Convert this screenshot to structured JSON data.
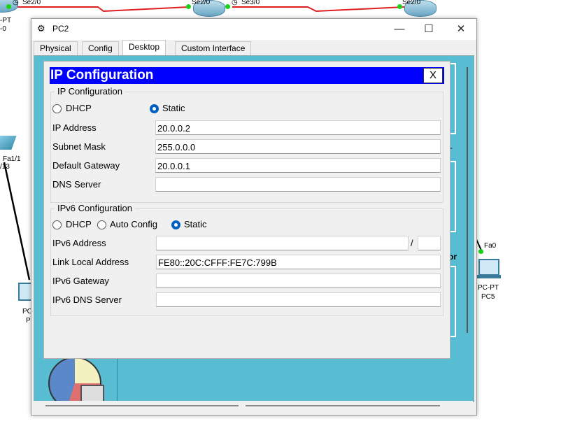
{
  "topology": {
    "top_labels": [
      "Se2/0",
      "Se2/0",
      "Se3/0",
      "Se2/0"
    ],
    "left_labels": [
      "-PT",
      "-0",
      "Fa1/1",
      "/13",
      "PC",
      "P"
    ],
    "right_pc": {
      "port": "Fa0",
      "type": "PC-PT",
      "name": "PC5"
    },
    "link_color": "#e02020"
  },
  "window": {
    "title": "PC2",
    "controls": {
      "minimize": "—",
      "maximize": "☐",
      "close": "✕"
    },
    "tabs": [
      {
        "label": "Physical",
        "active": false
      },
      {
        "label": "Config",
        "active": false
      },
      {
        "label": "Desktop",
        "active": true
      },
      {
        "label": "Custom Interface",
        "active": false
      }
    ],
    "desktop_side_text": {
      "or": "or",
      "bar": "l",
      "dash": "-"
    }
  },
  "ip_config": {
    "title": "IP Configuration",
    "close_label": "X",
    "ipv4": {
      "legend": "IP Configuration",
      "mode_options": [
        "DHCP",
        "Static"
      ],
      "selected_mode": "Static",
      "fields": {
        "ip_address": {
          "label": "IP Address",
          "value": "20.0.0.2"
        },
        "subnet_mask": {
          "label": "Subnet Mask",
          "value": "255.0.0.0"
        },
        "default_gateway": {
          "label": "Default Gateway",
          "value": "20.0.0.1"
        },
        "dns_server": {
          "label": "DNS Server",
          "value": ""
        }
      }
    },
    "ipv6": {
      "legend": "IPv6 Configuration",
      "mode_options": [
        "DHCP",
        "Auto Config",
        "Static"
      ],
      "selected_mode": "Static",
      "prefix_separator": "/",
      "fields": {
        "ipv6_address": {
          "label": "IPv6 Address",
          "value": "",
          "prefix": ""
        },
        "link_local_address": {
          "label": "Link Local Address",
          "value": "FE80::20C:CFFF:FE7C:799B"
        },
        "ipv6_gateway": {
          "label": "IPv6 Gateway",
          "value": ""
        },
        "ipv6_dns_server": {
          "label": "IPv6 DNS Server",
          "value": ""
        }
      }
    },
    "colors": {
      "title_bar": "#0000ff",
      "desktop_bg": "#58bcd3",
      "radio_selected": "#0060c0"
    }
  }
}
